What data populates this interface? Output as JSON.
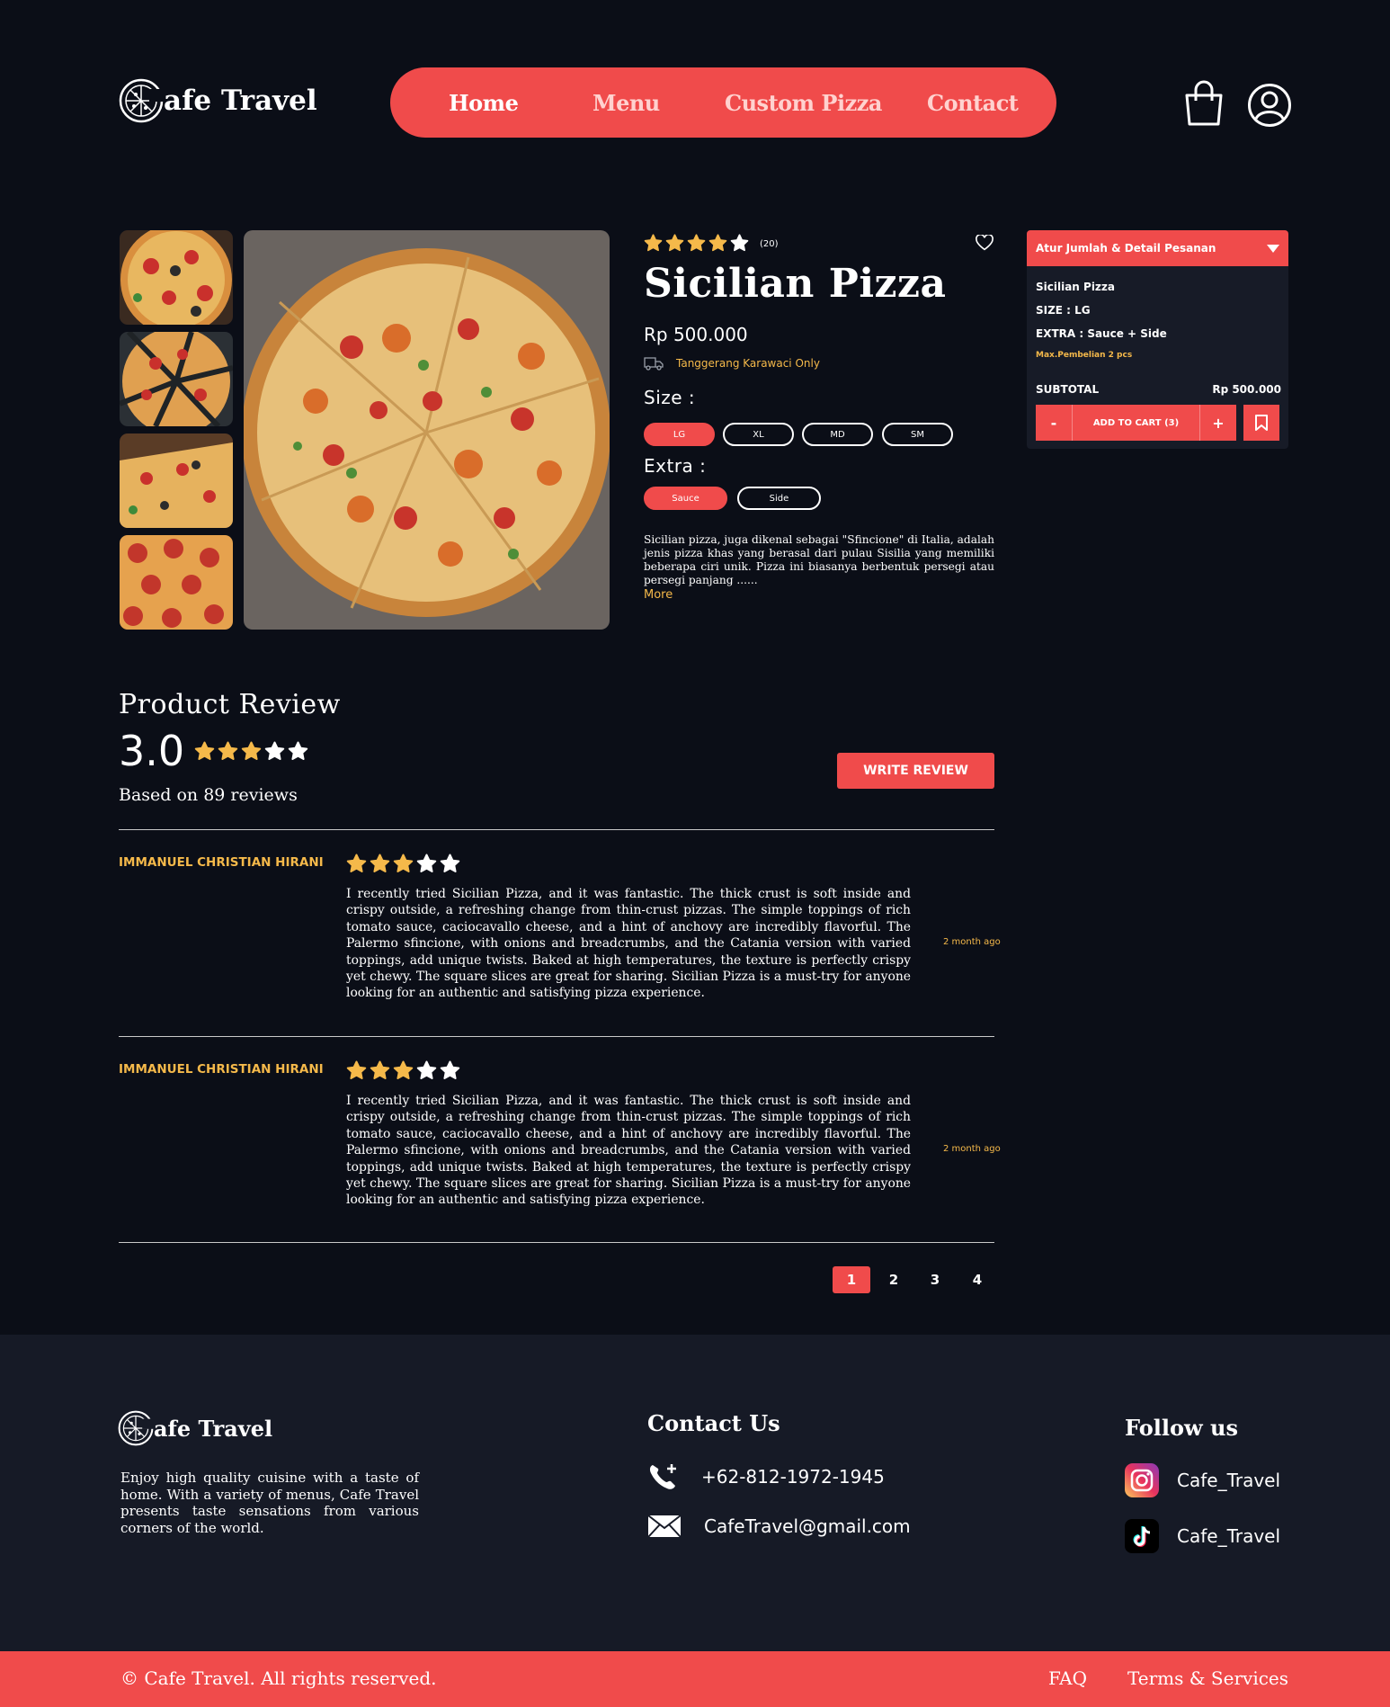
{
  "brand": {
    "name_rest": "afe Travel",
    "accent": "#f04b4b",
    "gold": "#f5b94a"
  },
  "nav": {
    "items": [
      "Home",
      "Menu",
      "Custom Pizza",
      "Contact"
    ],
    "active": "Home"
  },
  "header_icons": [
    "shopping-bag-icon",
    "user-profile-icon"
  ],
  "gallery": {
    "thumbnails": 4
  },
  "product": {
    "rating": 4,
    "rating_count": "(20)",
    "title": "Sicilian Pizza",
    "price": "Rp 500.000",
    "shipping": "Tanggerang Karawaci Only",
    "size_label": "Size :",
    "sizes": [
      "LG",
      "XL",
      "MD",
      "SM"
    ],
    "selected_size": "LG",
    "extra_label": "Extra :",
    "extras": [
      "Sauce",
      "Side"
    ],
    "selected_extra": "Sauce",
    "description": "Sicilian pizza, juga dikenal sebagai \"Sfincione\" di Italia, adalah jenis pizza khas yang berasal dari pulau Sisilia yang memiliki beberapa ciri unik. Pizza ini biasanya berbentuk persegi atau persegi panjang ......",
    "more": "More"
  },
  "order_panel": {
    "title": "Atur Jumlah & Detail Pesanan",
    "name": "Sicilian Pizza",
    "size": "SIZE : LG",
    "extra": "EXTRA : Sauce + Side",
    "limit": "Max.Pembelian 2 pcs",
    "subtotal_label": "SUBTOTAL",
    "subtotal_value": "Rp 500.000",
    "minus": "-",
    "add_to_cart": "ADD TO CART (3)",
    "plus": "+"
  },
  "reviews": {
    "title": "Product Review",
    "score": "3.0",
    "score_stars": 3,
    "based_on": "Based on 89 reviews",
    "write_button": "WRITE REVIEW",
    "items": [
      {
        "name": "IMMANUEL CHRISTIAN HIRANI",
        "stars": 3,
        "text": "I recently tried Sicilian Pizza, and it was fantastic. The thick crust is soft inside and crispy outside, a refreshing change from thin-crust pizzas. The simple toppings of rich tomato sauce, caciocavallo cheese, and a hint of anchovy are incredibly flavorful. The Palermo sfincione, with onions and breadcrumbs, and the Catania version with varied toppings, add unique twists. Baked at high temperatures, the texture is perfectly crispy yet chewy. The square slices are great for sharing. Sicilian Pizza is a must-try for anyone looking for an authentic and satisfying pizza experience.",
        "time": "2 month ago"
      },
      {
        "name": "IMMANUEL CHRISTIAN HIRANI",
        "stars": 3,
        "text": "I recently tried Sicilian Pizza, and it was fantastic. The thick crust is soft inside and crispy outside, a refreshing change from thin-crust pizzas. The simple toppings of rich tomato sauce, caciocavallo cheese, and a hint of anchovy are incredibly flavorful. The Palermo sfincione, with onions and breadcrumbs, and the Catania version with varied toppings, add unique twists. Baked at high temperatures, the texture is perfectly crispy yet chewy. The square slices are great for sharing. Sicilian Pizza is a must-try for anyone looking for an authentic and satisfying pizza experience.",
        "time": "2 month ago"
      }
    ],
    "pages": [
      "1",
      "2",
      "3",
      "4"
    ],
    "current_page": "1"
  },
  "footer": {
    "description": "Enjoy high quality cuisine with a taste of home. With a variety of menus, Cafe Travel presents taste sensations from various corners of the world.",
    "contact_title": "Contact Us",
    "phone": "+62-812-1972-1945",
    "email": "CafeTravel@gmail.com",
    "follow_title": "Follow us",
    "instagram": "Cafe_Travel",
    "tiktok": "Cafe_Travel",
    "copyright": "© Cafe Travel. All rights reserved.",
    "faq": "FAQ",
    "terms": "Terms & Services"
  }
}
